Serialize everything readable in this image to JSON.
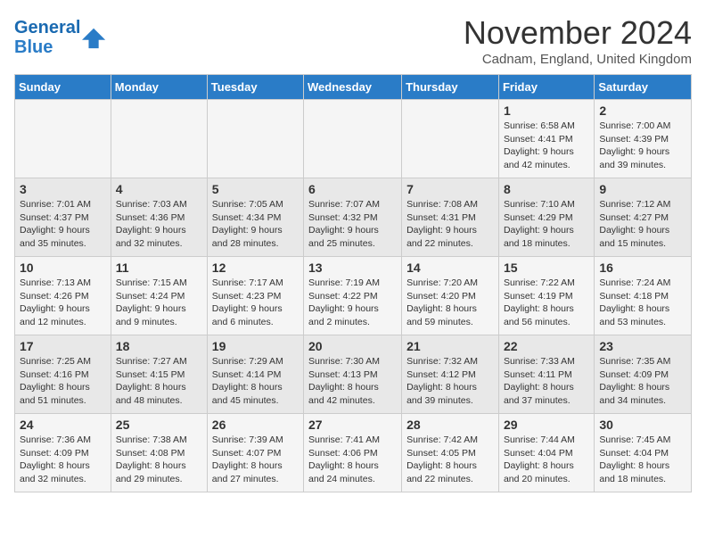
{
  "header": {
    "logo_line1": "General",
    "logo_line2": "Blue",
    "month_title": "November 2024",
    "subtitle": "Cadnam, England, United Kingdom"
  },
  "days_of_week": [
    "Sunday",
    "Monday",
    "Tuesday",
    "Wednesday",
    "Thursday",
    "Friday",
    "Saturday"
  ],
  "weeks": [
    [
      {
        "day": "",
        "info": ""
      },
      {
        "day": "",
        "info": ""
      },
      {
        "day": "",
        "info": ""
      },
      {
        "day": "",
        "info": ""
      },
      {
        "day": "",
        "info": ""
      },
      {
        "day": "1",
        "info": "Sunrise: 6:58 AM\nSunset: 4:41 PM\nDaylight: 9 hours and 42 minutes."
      },
      {
        "day": "2",
        "info": "Sunrise: 7:00 AM\nSunset: 4:39 PM\nDaylight: 9 hours and 39 minutes."
      }
    ],
    [
      {
        "day": "3",
        "info": "Sunrise: 7:01 AM\nSunset: 4:37 PM\nDaylight: 9 hours and 35 minutes."
      },
      {
        "day": "4",
        "info": "Sunrise: 7:03 AM\nSunset: 4:36 PM\nDaylight: 9 hours and 32 minutes."
      },
      {
        "day": "5",
        "info": "Sunrise: 7:05 AM\nSunset: 4:34 PM\nDaylight: 9 hours and 28 minutes."
      },
      {
        "day": "6",
        "info": "Sunrise: 7:07 AM\nSunset: 4:32 PM\nDaylight: 9 hours and 25 minutes."
      },
      {
        "day": "7",
        "info": "Sunrise: 7:08 AM\nSunset: 4:31 PM\nDaylight: 9 hours and 22 minutes."
      },
      {
        "day": "8",
        "info": "Sunrise: 7:10 AM\nSunset: 4:29 PM\nDaylight: 9 hours and 18 minutes."
      },
      {
        "day": "9",
        "info": "Sunrise: 7:12 AM\nSunset: 4:27 PM\nDaylight: 9 hours and 15 minutes."
      }
    ],
    [
      {
        "day": "10",
        "info": "Sunrise: 7:13 AM\nSunset: 4:26 PM\nDaylight: 9 hours and 12 minutes."
      },
      {
        "day": "11",
        "info": "Sunrise: 7:15 AM\nSunset: 4:24 PM\nDaylight: 9 hours and 9 minutes."
      },
      {
        "day": "12",
        "info": "Sunrise: 7:17 AM\nSunset: 4:23 PM\nDaylight: 9 hours and 6 minutes."
      },
      {
        "day": "13",
        "info": "Sunrise: 7:19 AM\nSunset: 4:22 PM\nDaylight: 9 hours and 2 minutes."
      },
      {
        "day": "14",
        "info": "Sunrise: 7:20 AM\nSunset: 4:20 PM\nDaylight: 8 hours and 59 minutes."
      },
      {
        "day": "15",
        "info": "Sunrise: 7:22 AM\nSunset: 4:19 PM\nDaylight: 8 hours and 56 minutes."
      },
      {
        "day": "16",
        "info": "Sunrise: 7:24 AM\nSunset: 4:18 PM\nDaylight: 8 hours and 53 minutes."
      }
    ],
    [
      {
        "day": "17",
        "info": "Sunrise: 7:25 AM\nSunset: 4:16 PM\nDaylight: 8 hours and 51 minutes."
      },
      {
        "day": "18",
        "info": "Sunrise: 7:27 AM\nSunset: 4:15 PM\nDaylight: 8 hours and 48 minutes."
      },
      {
        "day": "19",
        "info": "Sunrise: 7:29 AM\nSunset: 4:14 PM\nDaylight: 8 hours and 45 minutes."
      },
      {
        "day": "20",
        "info": "Sunrise: 7:30 AM\nSunset: 4:13 PM\nDaylight: 8 hours and 42 minutes."
      },
      {
        "day": "21",
        "info": "Sunrise: 7:32 AM\nSunset: 4:12 PM\nDaylight: 8 hours and 39 minutes."
      },
      {
        "day": "22",
        "info": "Sunrise: 7:33 AM\nSunset: 4:11 PM\nDaylight: 8 hours and 37 minutes."
      },
      {
        "day": "23",
        "info": "Sunrise: 7:35 AM\nSunset: 4:09 PM\nDaylight: 8 hours and 34 minutes."
      }
    ],
    [
      {
        "day": "24",
        "info": "Sunrise: 7:36 AM\nSunset: 4:09 PM\nDaylight: 8 hours and 32 minutes."
      },
      {
        "day": "25",
        "info": "Sunrise: 7:38 AM\nSunset: 4:08 PM\nDaylight: 8 hours and 29 minutes."
      },
      {
        "day": "26",
        "info": "Sunrise: 7:39 AM\nSunset: 4:07 PM\nDaylight: 8 hours and 27 minutes."
      },
      {
        "day": "27",
        "info": "Sunrise: 7:41 AM\nSunset: 4:06 PM\nDaylight: 8 hours and 24 minutes."
      },
      {
        "day": "28",
        "info": "Sunrise: 7:42 AM\nSunset: 4:05 PM\nDaylight: 8 hours and 22 minutes."
      },
      {
        "day": "29",
        "info": "Sunrise: 7:44 AM\nSunset: 4:04 PM\nDaylight: 8 hours and 20 minutes."
      },
      {
        "day": "30",
        "info": "Sunrise: 7:45 AM\nSunset: 4:04 PM\nDaylight: 8 hours and 18 minutes."
      }
    ]
  ]
}
